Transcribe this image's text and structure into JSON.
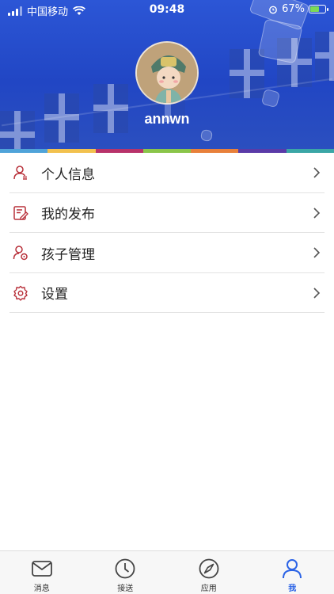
{
  "status_bar": {
    "carrier": "中国移动",
    "time": "09:48",
    "battery_percent": "67%",
    "battery_level": 0.67
  },
  "profile": {
    "username": "annwn"
  },
  "color_strip": [
    "#4fa3d9",
    "#f2c14e",
    "#b8336a",
    "#8ac54a",
    "#e8803a",
    "#5a3aa8",
    "#3aa6a6"
  ],
  "menu": {
    "items": [
      {
        "label": "个人信息",
        "icon": "user-icon"
      },
      {
        "label": "我的发布",
        "icon": "edit-document-icon"
      },
      {
        "label": "孩子管理",
        "icon": "child-settings-icon"
      },
      {
        "label": "设置",
        "icon": "gear-icon"
      }
    ]
  },
  "tabbar": {
    "tabs": [
      {
        "label": "消息",
        "icon": "mail-icon",
        "active": false
      },
      {
        "label": "接送",
        "icon": "clock-icon",
        "active": false
      },
      {
        "label": "应用",
        "icon": "compass-icon",
        "active": false
      },
      {
        "label": "我",
        "icon": "person-icon",
        "active": true
      }
    ]
  },
  "colors": {
    "accent": "#2b63e6",
    "icon_red": "#b8303a",
    "header_blue": "#2c56d6"
  }
}
